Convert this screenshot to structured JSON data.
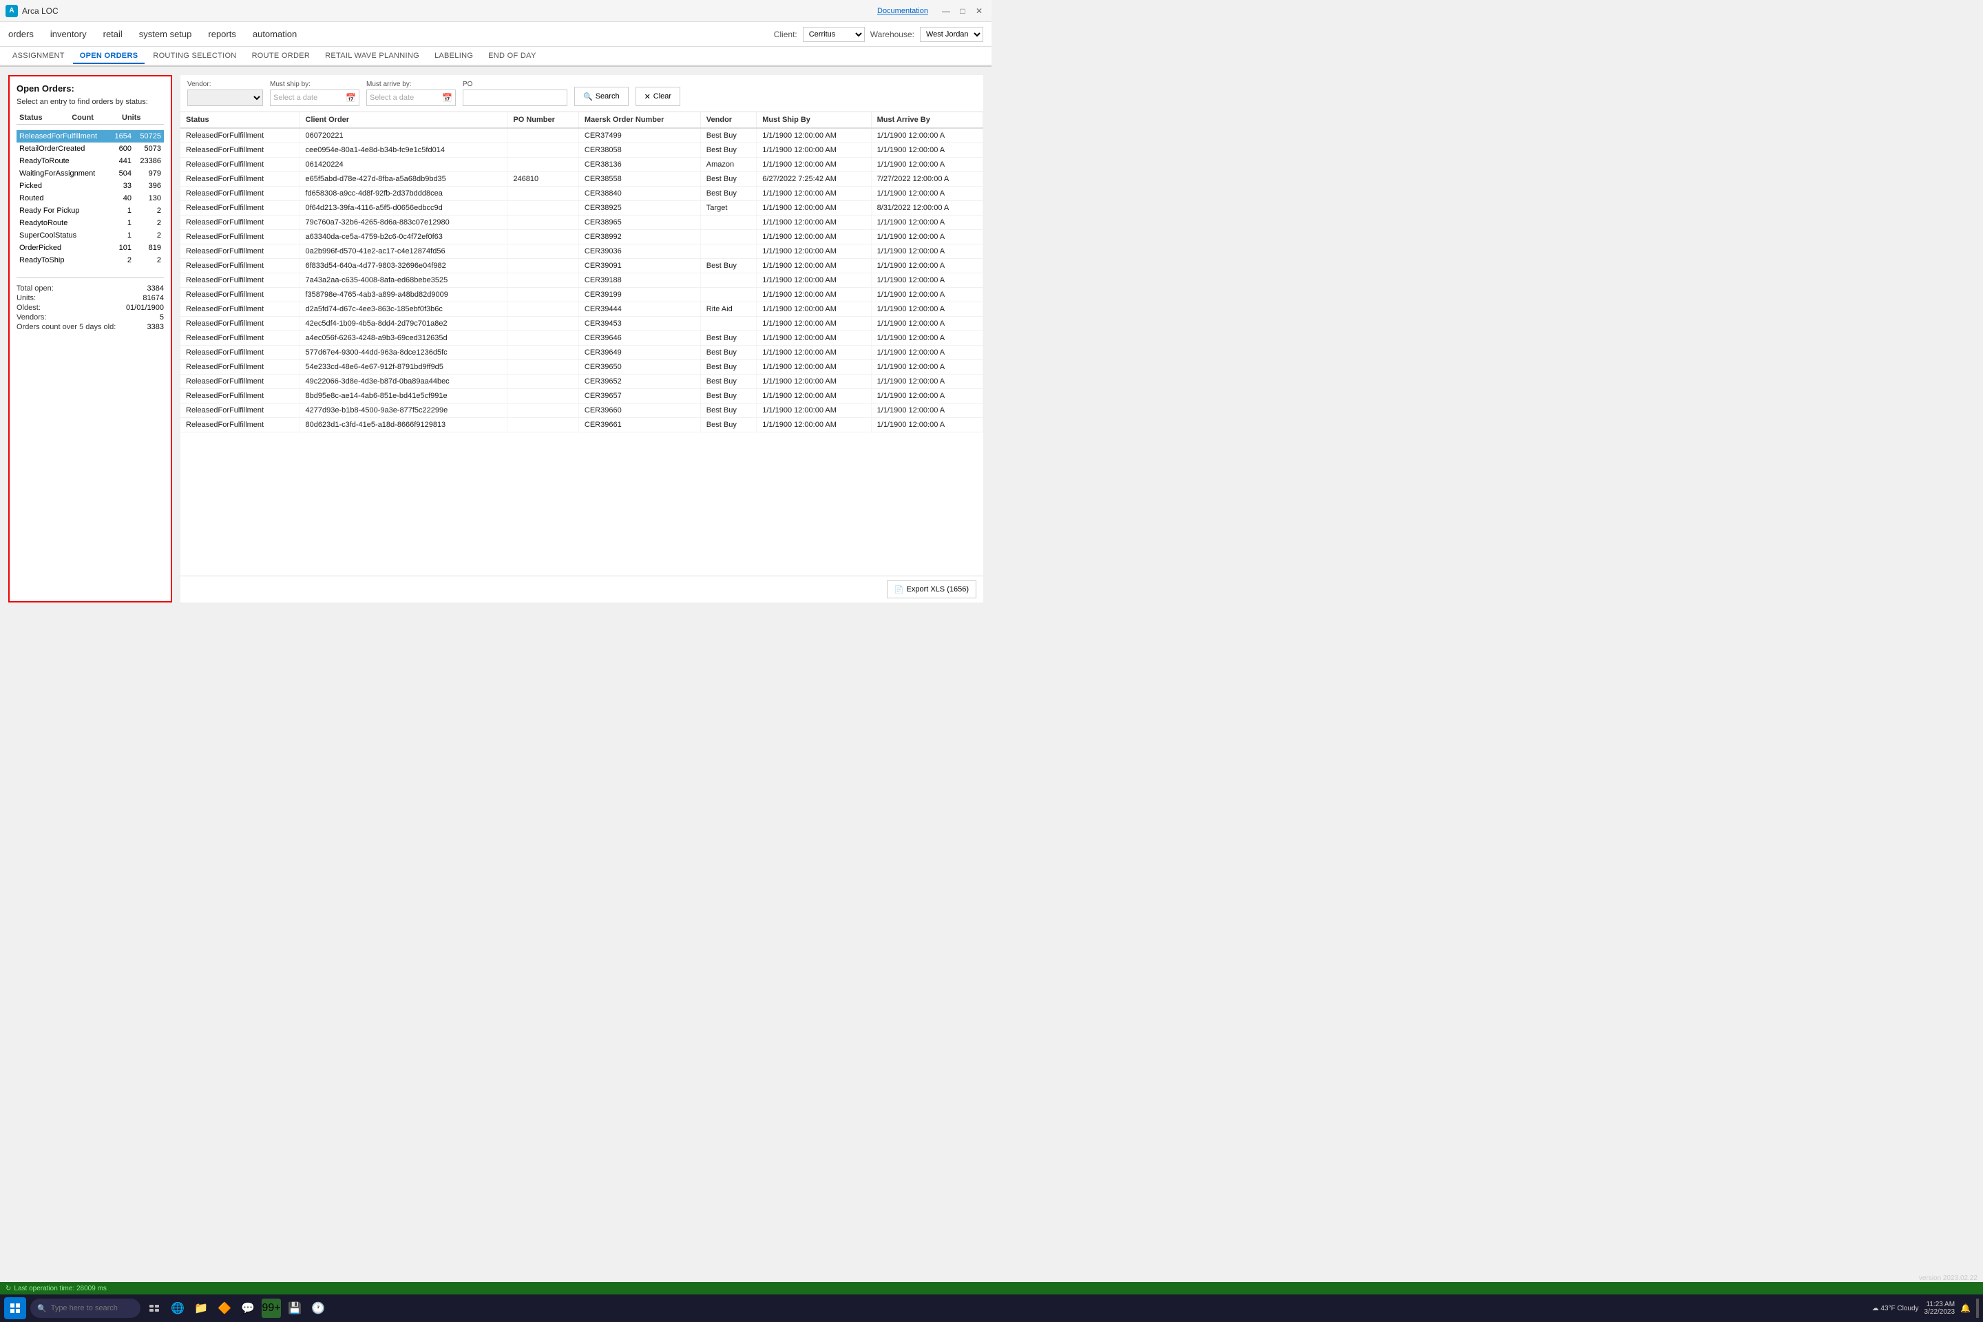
{
  "app": {
    "title": "Arca LOC",
    "doc_link": "Documentation"
  },
  "title_controls": {
    "minimize": "—",
    "maximize": "□",
    "close": "✕"
  },
  "top_nav": {
    "items": [
      "orders",
      "inventory",
      "retail",
      "system setup",
      "reports",
      "automation"
    ]
  },
  "client_bar": {
    "client_label": "Client:",
    "client_value": "Cerritus",
    "warehouse_label": "Warehouse:",
    "warehouse_value": "West Jordan"
  },
  "sub_nav": {
    "items": [
      "ASSIGNMENT",
      "OPEN ORDERS",
      "ROUTING SELECTION",
      "ROUTE ORDER",
      "RETAIL WAVE PLANNING",
      "LABELING",
      "END OF DAY"
    ],
    "active": "OPEN ORDERS"
  },
  "left_panel": {
    "title": "Open Orders:",
    "subtitle": "Select an entry to find orders by status:",
    "columns": [
      "Status",
      "Count",
      "Units"
    ],
    "rows": [
      {
        "status": "ReleasedForFulfillment",
        "count": "1654",
        "units": "50725",
        "selected": true
      },
      {
        "status": "RetailOrderCreated",
        "count": "600",
        "units": "5073",
        "selected": false
      },
      {
        "status": "ReadyToRoute",
        "count": "441",
        "units": "23386",
        "selected": false
      },
      {
        "status": "WaitingForAssignment",
        "count": "504",
        "units": "979",
        "selected": false
      },
      {
        "status": "Picked",
        "count": "33",
        "units": "396",
        "selected": false
      },
      {
        "status": "Routed",
        "count": "40",
        "units": "130",
        "selected": false
      },
      {
        "status": "Ready For Pickup",
        "count": "1",
        "units": "2",
        "selected": false
      },
      {
        "status": "ReadytoRoute",
        "count": "1",
        "units": "2",
        "selected": false
      },
      {
        "status": "SuperCoolStatus",
        "count": "1",
        "units": "2",
        "selected": false
      },
      {
        "status": "OrderPicked",
        "count": "101",
        "units": "819",
        "selected": false
      },
      {
        "status": "ReadyToShip",
        "count": "2",
        "units": "2",
        "selected": false
      }
    ],
    "summary": {
      "total_open_label": "Total open:",
      "total_open_value": "3384",
      "units_label": "Units:",
      "units_value": "81674",
      "oldest_label": "Oldest:",
      "oldest_value": "01/01/1900",
      "vendors_label": "Vendors:",
      "vendors_value": "5",
      "over5days_label": "Orders count over 5 days old:",
      "over5days_value": "3383"
    }
  },
  "filter_bar": {
    "vendor_label": "Vendor:",
    "vendor_placeholder": "",
    "must_ship_label": "Must ship by:",
    "must_ship_placeholder": "Select a date",
    "must_arrive_label": "Must arrive by:",
    "must_arrive_placeholder": "Select a date",
    "po_label": "PO",
    "po_placeholder": "",
    "search_btn": "Search",
    "clear_btn": "Clear"
  },
  "data_table": {
    "columns": [
      "Status",
      "Client Order",
      "PO Number",
      "Maersk Order Number",
      "Vendor",
      "Must Ship By",
      "Must Arrive By"
    ],
    "rows": [
      {
        "status": "ReleasedForFulfillment",
        "client_order": "060720221",
        "po_number": "",
        "maersk_order": "CER37499",
        "vendor": "Best Buy",
        "must_ship": "1/1/1900 12:00:00 AM",
        "must_arrive": "1/1/1900 12:00:00 A"
      },
      {
        "status": "ReleasedForFulfillment",
        "client_order": "cee0954e-80a1-4e8d-b34b-fc9e1c5fd014",
        "po_number": "",
        "maersk_order": "CER38058",
        "vendor": "Best Buy",
        "must_ship": "1/1/1900 12:00:00 AM",
        "must_arrive": "1/1/1900 12:00:00 A"
      },
      {
        "status": "ReleasedForFulfillment",
        "client_order": "061420224",
        "po_number": "",
        "maersk_order": "CER38136",
        "vendor": "Amazon",
        "must_ship": "1/1/1900 12:00:00 AM",
        "must_arrive": "1/1/1900 12:00:00 A"
      },
      {
        "status": "ReleasedForFulfillment",
        "client_order": "e65f5abd-d78e-427d-8fba-a5a68db9bd35",
        "po_number": "246810",
        "maersk_order": "CER38558",
        "vendor": "Best Buy",
        "must_ship": "6/27/2022 7:25:42 AM",
        "must_arrive": "7/27/2022 12:00:00 A"
      },
      {
        "status": "ReleasedForFulfillment",
        "client_order": "fd658308-a9cc-4d8f-92fb-2d37bddd8cea",
        "po_number": "",
        "maersk_order": "CER38840",
        "vendor": "Best Buy",
        "must_ship": "1/1/1900 12:00:00 AM",
        "must_arrive": "1/1/1900 12:00:00 A"
      },
      {
        "status": "ReleasedForFulfillment",
        "client_order": "0f64d213-39fa-4116-a5f5-d0656edbcc9d",
        "po_number": "",
        "maersk_order": "CER38925",
        "vendor": "Target",
        "must_ship": "1/1/1900 12:00:00 AM",
        "must_arrive": "8/31/2022 12:00:00 A"
      },
      {
        "status": "ReleasedForFulfillment",
        "client_order": "79c760a7-32b6-4265-8d6a-883c07e12980",
        "po_number": "",
        "maersk_order": "CER38965",
        "vendor": "",
        "must_ship": "1/1/1900 12:00:00 AM",
        "must_arrive": "1/1/1900 12:00:00 A"
      },
      {
        "status": "ReleasedForFulfillment",
        "client_order": "a63340da-ce5a-4759-b2c6-0c4f72ef0f63",
        "po_number": "",
        "maersk_order": "CER38992",
        "vendor": "",
        "must_ship": "1/1/1900 12:00:00 AM",
        "must_arrive": "1/1/1900 12:00:00 A"
      },
      {
        "status": "ReleasedForFulfillment",
        "client_order": "0a2b996f-d570-41e2-ac17-c4e12874fd56",
        "po_number": "",
        "maersk_order": "CER39036",
        "vendor": "",
        "must_ship": "1/1/1900 12:00:00 AM",
        "must_arrive": "1/1/1900 12:00:00 A"
      },
      {
        "status": "ReleasedForFulfillment",
        "client_order": "6f833d54-640a-4d77-9803-32696e04f982",
        "po_number": "",
        "maersk_order": "CER39091",
        "vendor": "Best Buy",
        "must_ship": "1/1/1900 12:00:00 AM",
        "must_arrive": "1/1/1900 12:00:00 A"
      },
      {
        "status": "ReleasedForFulfillment",
        "client_order": "7a43a2aa-c635-4008-8afa-ed68bebe3525",
        "po_number": "",
        "maersk_order": "CER39188",
        "vendor": "",
        "must_ship": "1/1/1900 12:00:00 AM",
        "must_arrive": "1/1/1900 12:00:00 A"
      },
      {
        "status": "ReleasedForFulfillment",
        "client_order": "f358798e-4765-4ab3-a899-a48bd82d9009",
        "po_number": "",
        "maersk_order": "CER39199",
        "vendor": "",
        "must_ship": "1/1/1900 12:00:00 AM",
        "must_arrive": "1/1/1900 12:00:00 A"
      },
      {
        "status": "ReleasedForFulfillment",
        "client_order": "d2a5fd74-d67c-4ee3-863c-185ebf0f3b6c",
        "po_number": "",
        "maersk_order": "CER39444",
        "vendor": "Rite Aid",
        "must_ship": "1/1/1900 12:00:00 AM",
        "must_arrive": "1/1/1900 12:00:00 A"
      },
      {
        "status": "ReleasedForFulfillment",
        "client_order": "42ec5df4-1b09-4b5a-8dd4-2d79c701a8e2",
        "po_number": "",
        "maersk_order": "CER39453",
        "vendor": "",
        "must_ship": "1/1/1900 12:00:00 AM",
        "must_arrive": "1/1/1900 12:00:00 A"
      },
      {
        "status": "ReleasedForFulfillment",
        "client_order": "a4ec056f-6263-4248-a9b3-69ced312635d",
        "po_number": "",
        "maersk_order": "CER39646",
        "vendor": "Best Buy",
        "must_ship": "1/1/1900 12:00:00 AM",
        "must_arrive": "1/1/1900 12:00:00 A"
      },
      {
        "status": "ReleasedForFulfillment",
        "client_order": "577d67e4-9300-44dd-963a-8dce1236d5fc",
        "po_number": "",
        "maersk_order": "CER39649",
        "vendor": "Best Buy",
        "must_ship": "1/1/1900 12:00:00 AM",
        "must_arrive": "1/1/1900 12:00:00 A"
      },
      {
        "status": "ReleasedForFulfillment",
        "client_order": "54e233cd-48e6-4e67-912f-8791bd9ff9d5",
        "po_number": "",
        "maersk_order": "CER39650",
        "vendor": "Best Buy",
        "must_ship": "1/1/1900 12:00:00 AM",
        "must_arrive": "1/1/1900 12:00:00 A"
      },
      {
        "status": "ReleasedForFulfillment",
        "client_order": "49c22066-3d8e-4d3e-b87d-0ba89aa44bec",
        "po_number": "",
        "maersk_order": "CER39652",
        "vendor": "Best Buy",
        "must_ship": "1/1/1900 12:00:00 AM",
        "must_arrive": "1/1/1900 12:00:00 A"
      },
      {
        "status": "ReleasedForFulfillment",
        "client_order": "8bd95e8c-ae14-4ab6-851e-bd41e5cf991e",
        "po_number": "",
        "maersk_order": "CER39657",
        "vendor": "Best Buy",
        "must_ship": "1/1/1900 12:00:00 AM",
        "must_arrive": "1/1/1900 12:00:00 A"
      },
      {
        "status": "ReleasedForFulfillment",
        "client_order": "4277d93e-b1b8-4500-9a3e-877f5c22299e",
        "po_number": "",
        "maersk_order": "CER39660",
        "vendor": "Best Buy",
        "must_ship": "1/1/1900 12:00:00 AM",
        "must_arrive": "1/1/1900 12:00:00 A"
      },
      {
        "status": "ReleasedForFulfillment",
        "client_order": "80d623d1-c3fd-41e5-a18d-8666f9129813",
        "po_number": "",
        "maersk_order": "CER39661",
        "vendor": "Best Buy",
        "must_ship": "1/1/1900 12:00:00 AM",
        "must_arrive": "1/1/1900 12:00:00 A"
      }
    ]
  },
  "export_btn": "Export XLS (1656)",
  "status_bar": {
    "spinner": "↻",
    "text": "Last operation time:  28009 ms",
    "version": "version 2023.02.22"
  },
  "taskbar": {
    "search_placeholder": "Type here to search",
    "time": "11:23 AM",
    "date": "3/22/2023",
    "weather": "43°F  Cloudy"
  }
}
